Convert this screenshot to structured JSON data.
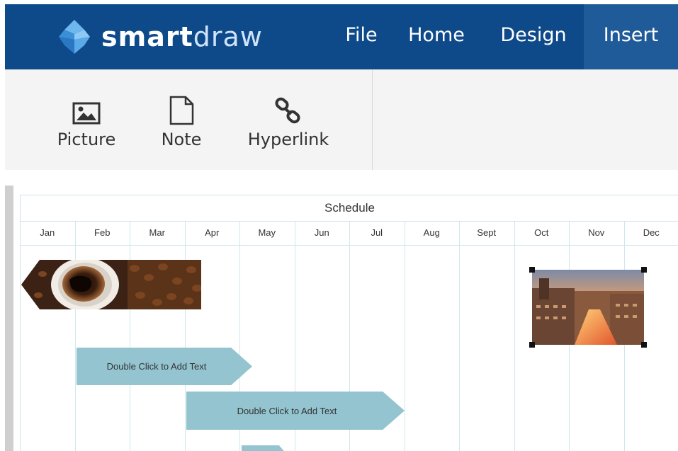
{
  "app": {
    "logo": {
      "text_bold": "smart",
      "text_light": "draw"
    },
    "menu": [
      "File",
      "Home",
      "Design",
      "Insert"
    ],
    "active_menu": "Insert",
    "colors": {
      "nav_bg": "#0e4a8a",
      "nav_active": "#205b99",
      "bar_fill": "#93c4cf",
      "grid_line": "#cfe7ec"
    }
  },
  "ribbon": {
    "tools": [
      {
        "label": "Picture",
        "icon": "picture-icon"
      },
      {
        "label": "Note",
        "icon": "note-icon"
      },
      {
        "label": "Hyperlink",
        "icon": "hyperlink-icon"
      }
    ]
  },
  "schedule": {
    "title": "Schedule",
    "months": [
      "Jan",
      "Feb",
      "Mar",
      "Apr",
      "May",
      "Jun",
      "Jul",
      "Aug",
      "Sept",
      "Oct",
      "Nov",
      "Dec"
    ],
    "bars": [
      {
        "label": "Double Click to Add Text"
      },
      {
        "label": "Double Click to Add Text"
      },
      {
        "label": ""
      }
    ],
    "images": [
      {
        "name": "coffee-image"
      },
      {
        "name": "city-image",
        "selected": true
      }
    ]
  }
}
